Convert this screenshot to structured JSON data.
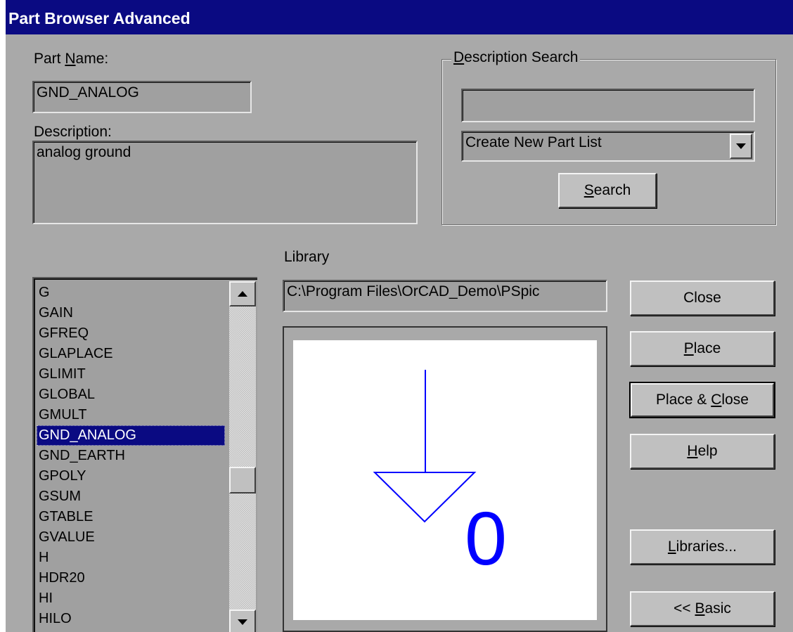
{
  "window": {
    "title": "Part Browser Advanced"
  },
  "part_name": {
    "label_pre": "Part ",
    "label_mnemonic": "N",
    "label_post": "ame:",
    "value": "GND_ANALOG"
  },
  "description": {
    "label": "Description:",
    "value": "analog ground"
  },
  "description_search": {
    "label_mnemonic": "D",
    "label_post": "escription Search",
    "input_value": "",
    "dropdown_value": "Create New Part List",
    "search_mnemonic": "S",
    "search_post": "earch"
  },
  "library": {
    "label": "Library",
    "value": "C:\\Program Files\\OrCAD_Demo\\PSpic"
  },
  "parts": {
    "items": [
      "G",
      "GAIN",
      "GFREQ",
      "GLAPLACE",
      "GLIMIT",
      "GLOBAL",
      "GMULT",
      "GND_ANALOG",
      "GND_EARTH",
      "GPOLY",
      "GSUM",
      "GTABLE",
      "GVALUE",
      "H",
      "HDR20",
      "HI",
      "HILO"
    ],
    "selected": "GND_ANALOG"
  },
  "preview": {
    "symbol": "ground-analog-symbol",
    "net_label": "0",
    "color": "#0000ff"
  },
  "buttons": {
    "close": "Close",
    "place_mnemonic": "P",
    "place_post": "lace",
    "place_close_pre": "Place & ",
    "place_close_mnemonic": "C",
    "place_close_post": "lose",
    "help_mnemonic": "H",
    "help_post": "elp",
    "libraries_mnemonic": "L",
    "libraries_post": "ibraries...",
    "basic_pre": "<< ",
    "basic_mnemonic": "B",
    "basic_post": "asic"
  },
  "colors": {
    "title_bar": "#0a0a82",
    "dialog_bg": "#a9a9a9",
    "selection": "#0a0a82"
  }
}
